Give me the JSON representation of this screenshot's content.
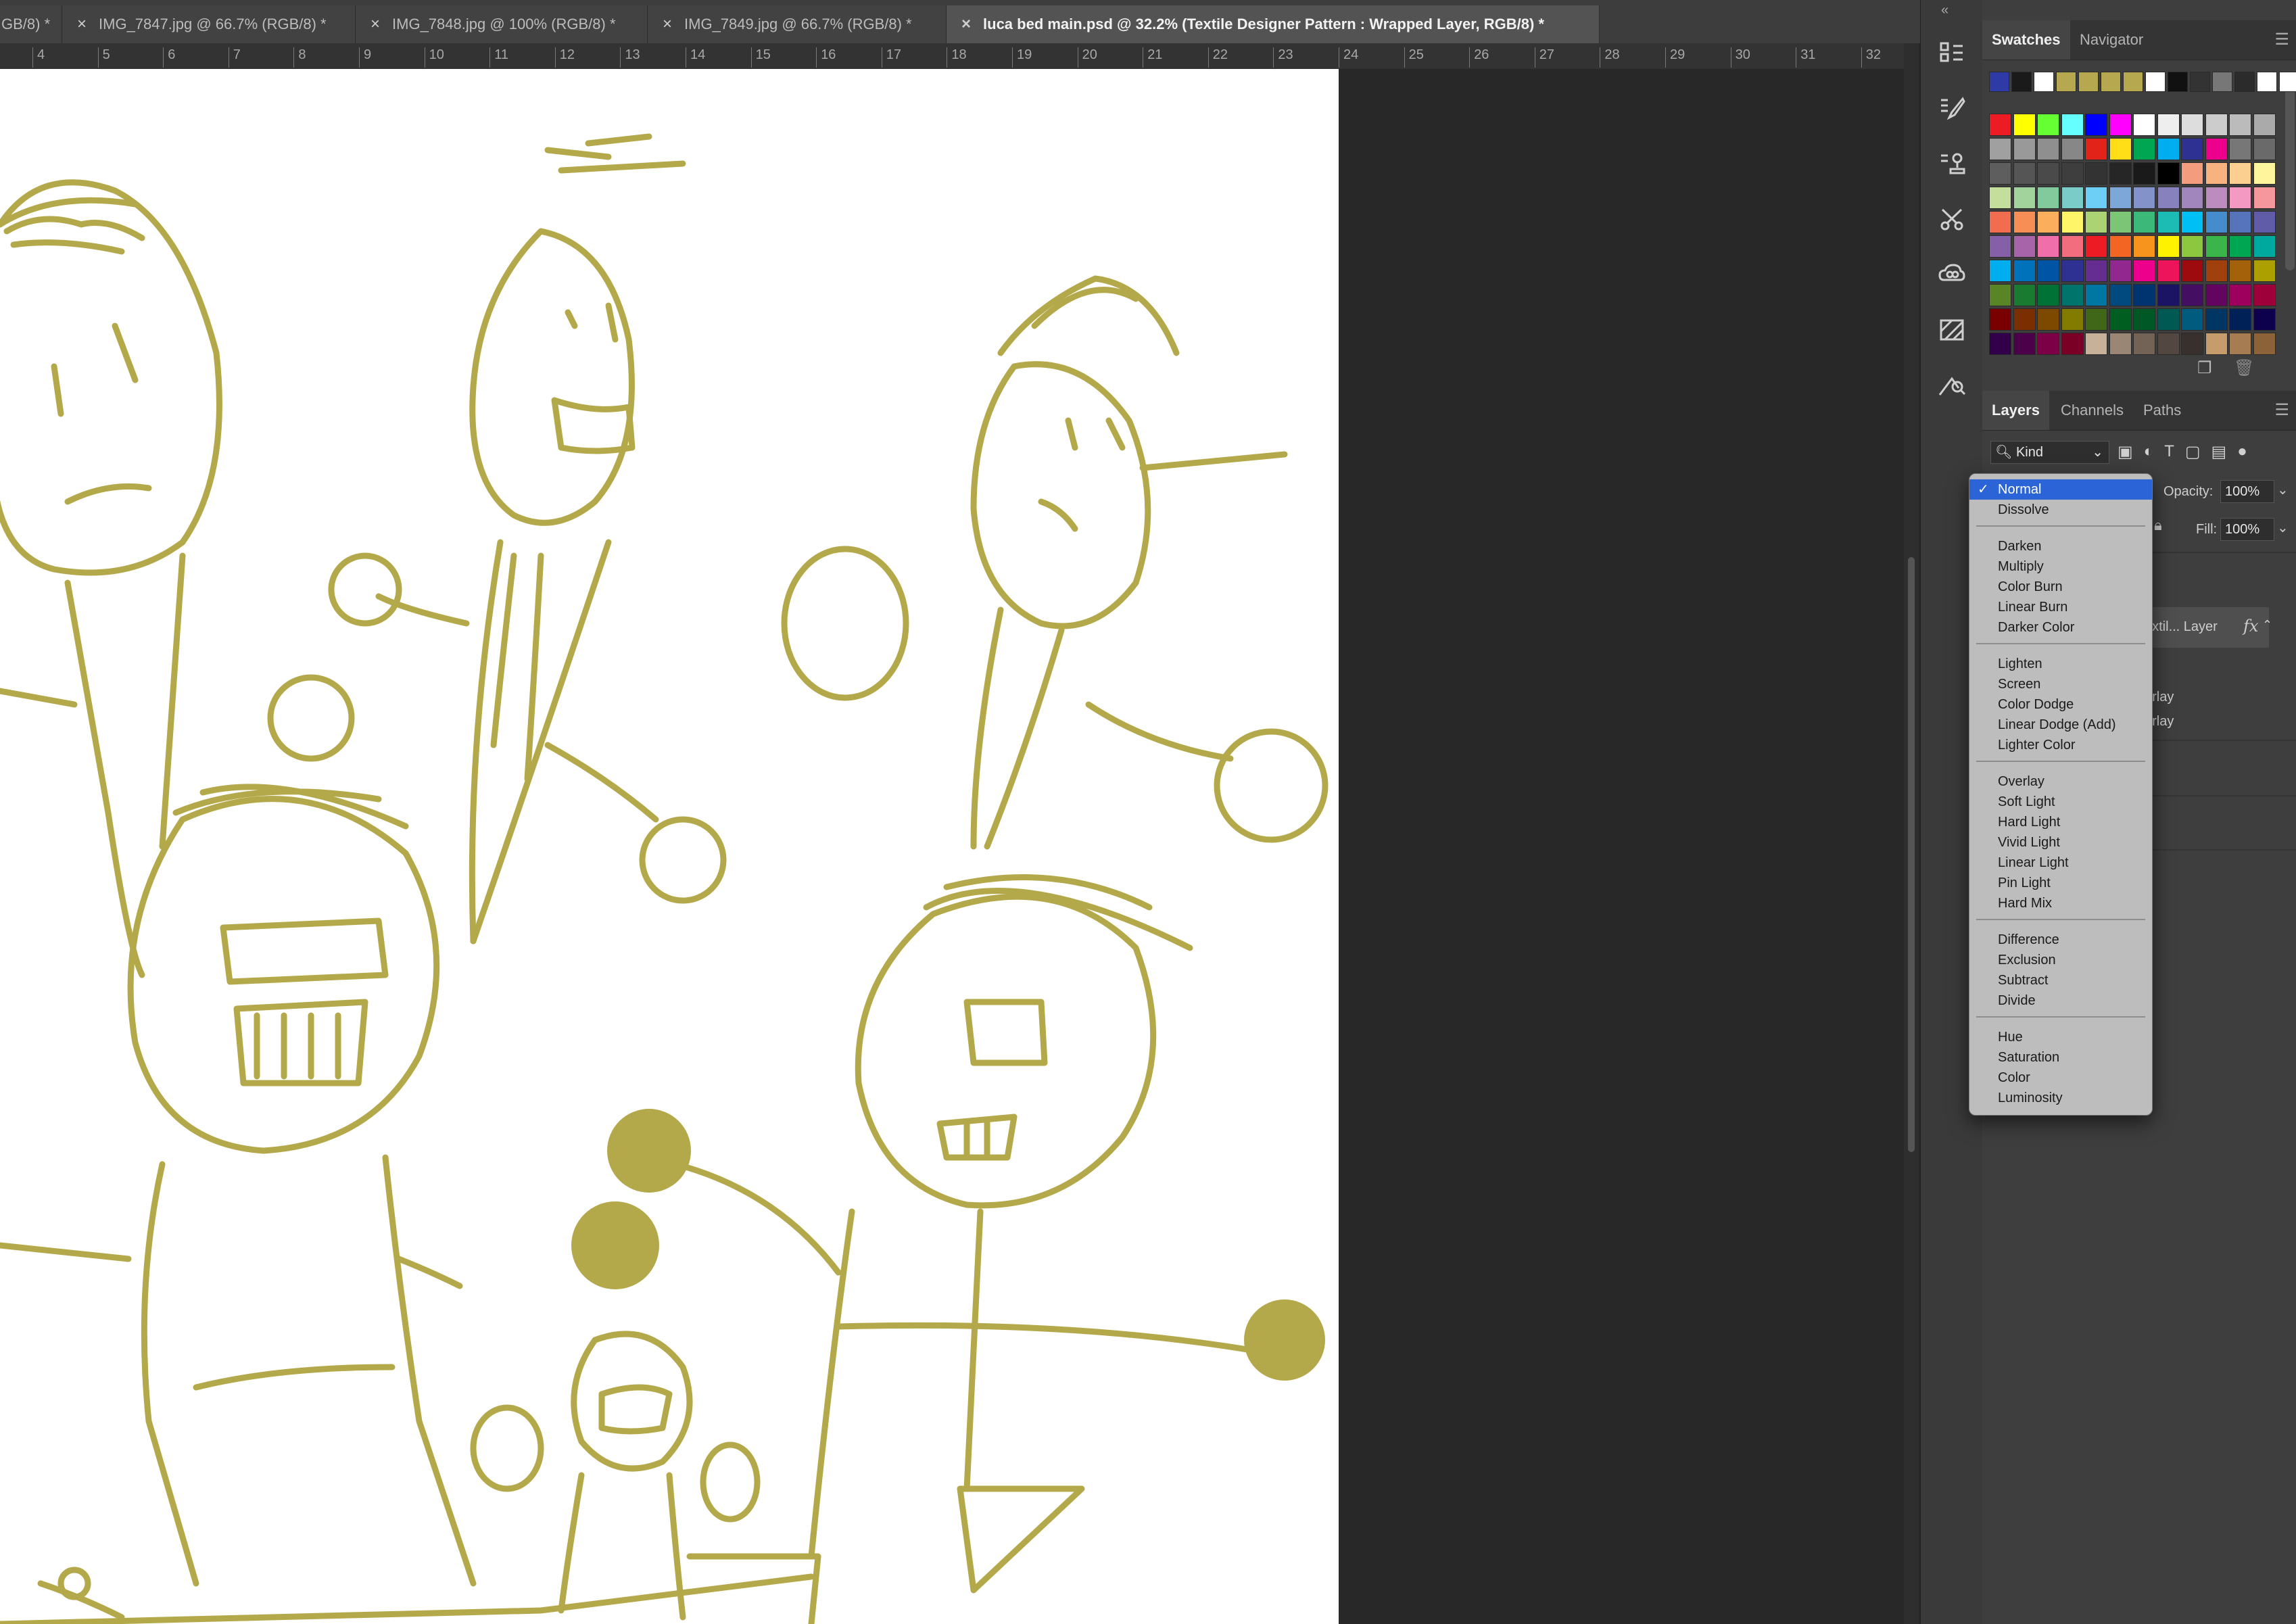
{
  "document_tabs": [
    {
      "label": "GB/8) *"
    },
    {
      "label": "IMG_7847.jpg @ 66.7% (RGB/8) *"
    },
    {
      "label": "IMG_7848.jpg @ 100% (RGB/8) *"
    },
    {
      "label": "IMG_7849.jpg @ 66.7% (RGB/8) *"
    },
    {
      "label": "luca bed main.psd @ 32.2% (Textile Designer Pattern : Wrapped Layer, RGB/8) *"
    }
  ],
  "ruler_ticks": [
    "4",
    "5",
    "6",
    "7",
    "8",
    "9",
    "10",
    "11",
    "12",
    "13",
    "14",
    "15",
    "16",
    "17",
    "18",
    "19",
    "20",
    "21",
    "22",
    "23",
    "24",
    "25",
    "26",
    "27",
    "28",
    "29",
    "30",
    "31",
    "32"
  ],
  "panels": {
    "swatches_tab": "Swatches",
    "navigator_tab": "Navigator",
    "layers_tab": "Layers",
    "channels_tab": "Channels",
    "paths_tab": "Paths",
    "kind_filter": "Kind",
    "opacity_label": "Opacity:",
    "opacity_value": "100%",
    "fill_label": "Fill:",
    "fill_value": "100%",
    "layer_name": "extil... Layer",
    "fx_label": "fx",
    "effect_1": "erlay",
    "effect_2": "erlay"
  },
  "recent_swatches": [
    "#2e3aa6",
    "#1a1a1a",
    "#ffffff",
    "#b5a84e",
    "#b5a84e",
    "#b5a84e",
    "#b5a84e",
    "#ffffff",
    "#111111",
    "#333333",
    "#777777",
    "#2b2b2b",
    "#ffffff",
    "#ffffff"
  ],
  "swatch_grid": [
    [
      "#ed1c24",
      "#ffff00",
      "#66ff33",
      "#66ffff",
      "#0000ff",
      "#ff00ff",
      "#ffffff",
      "#eeeeee",
      "#dddddd",
      "#cccccc",
      "#bbbbbb",
      "#aaaaaa"
    ],
    [
      "#a0a0a0",
      "#999999",
      "#8f8f8f",
      "#878787",
      "#e2231a",
      "#ffde17",
      "#00a651",
      "#00aeef",
      "#2e3192",
      "#ec008c",
      "#777777",
      "#6a6a6a"
    ],
    [
      "#5e5e5e",
      "#555555",
      "#4a4a4a",
      "#3e3e3e",
      "#333333",
      "#262626",
      "#1a1a1a",
      "#000000",
      "#f49c7e",
      "#f7b27f",
      "#fbcf8f",
      "#fff59d"
    ],
    [
      "#c4df9b",
      "#a3d39c",
      "#82ca9c",
      "#7accc8",
      "#6dcff6",
      "#7da7d9",
      "#8393ca",
      "#8781bd",
      "#a186be",
      "#bd8cbf",
      "#f49ac2",
      "#f5989d"
    ],
    [
      "#f26c4f",
      "#f68e56",
      "#fbaf5d",
      "#fff568",
      "#acd373",
      "#7cc576",
      "#3cb878",
      "#1cbbb4",
      "#00bff3",
      "#448ccb",
      "#5574b9",
      "#605ca8"
    ],
    [
      "#8560a8",
      "#a864a8",
      "#f06eaa",
      "#f26d7d",
      "#ed1c24",
      "#f26522",
      "#f7941d",
      "#fff200",
      "#8dc63f",
      "#39b54a",
      "#00a651",
      "#00a99d"
    ],
    [
      "#00aeef",
      "#0072bc",
      "#0054a6",
      "#2e3192",
      "#662d91",
      "#92278f",
      "#ec008c",
      "#ed145b",
      "#9e0b0f",
      "#a0410d",
      "#a36209",
      "#aba000"
    ],
    [
      "#598527",
      "#197b30",
      "#007236",
      "#00746b",
      "#0076a3",
      "#004a80",
      "#003471",
      "#1b1464",
      "#440e62",
      "#630460",
      "#9e005d",
      "#9e0039"
    ],
    [
      "#790000",
      "#7b2e00",
      "#7d4900",
      "#827b00",
      "#406618",
      "#005e20",
      "#005826",
      "#005952",
      "#005b7f",
      "#003663",
      "#002157",
      "#0d004c"
    ],
    [
      "#32004b",
      "#4b0049",
      "#7b0046",
      "#7a0026",
      "#c7b299",
      "#998675",
      "#736357",
      "#534741",
      "#37302d",
      "#c69c6d",
      "#a67c52",
      "#8c6239"
    ]
  ],
  "blend_mode_groups": [
    [
      "Normal",
      "Dissolve"
    ],
    [
      "Darken",
      "Multiply",
      "Color Burn",
      "Linear Burn",
      "Darker Color"
    ],
    [
      "Lighten",
      "Screen",
      "Color Dodge",
      "Linear Dodge (Add)",
      "Lighter Color"
    ],
    [
      "Overlay",
      "Soft Light",
      "Hard Light",
      "Vivid Light",
      "Linear Light",
      "Pin Light",
      "Hard Mix"
    ],
    [
      "Difference",
      "Exclusion",
      "Subtract",
      "Divide"
    ],
    [
      "Hue",
      "Saturation",
      "Color",
      "Luminosity"
    ]
  ],
  "selected_blend_mode": "Normal",
  "artwork_color": "#b4a94a"
}
